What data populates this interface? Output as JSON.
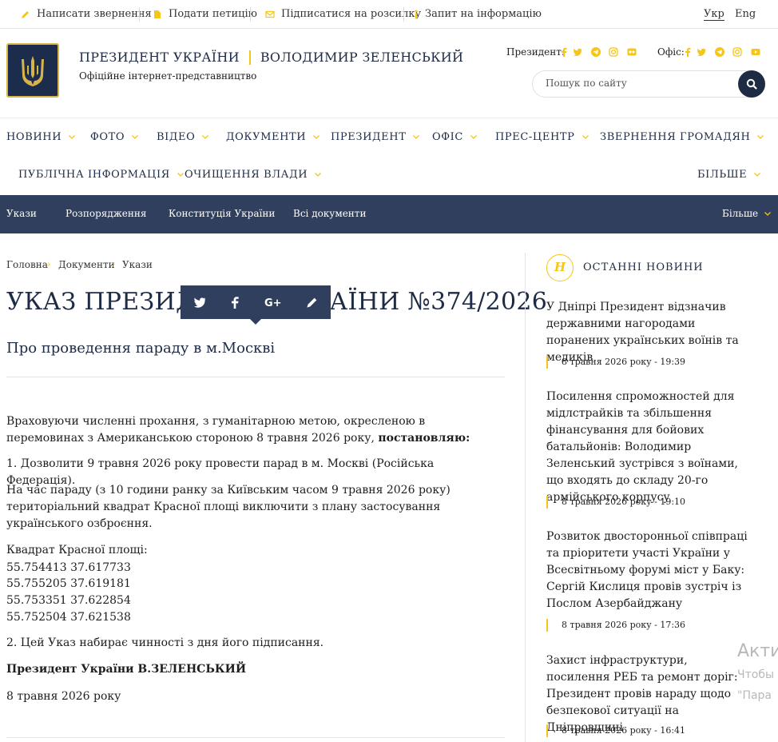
{
  "topbar": {
    "links": [
      "Написати звернення",
      "Подати петицію",
      "Підписатися на розсилку",
      "Запит на інформацію"
    ],
    "lang_active": "Укр",
    "lang_other": "Eng"
  },
  "header": {
    "title_left": "ПРЕЗИДЕНТ УКРАЇНИ",
    "title_right": "ВОЛОДИМИР ЗЕЛЕНСЬКИЙ",
    "subtitle": "Офіційне інтернет-представництво",
    "president_label": "Президент:",
    "office_label": "Офіс:",
    "search_placeholder": "Пошук по сайту"
  },
  "nav": {
    "row1": [
      "НОВИНИ",
      "ФОТО",
      "ВІДЕО",
      "ДОКУМЕНТИ",
      "ПРЕЗИДЕНТ",
      "ОФІС",
      "ПРЕС-ЦЕНТР",
      "ЗВЕРНЕННЯ ГРОМАДЯН"
    ],
    "row2": [
      "ПУБЛІЧНА ІНФОРМАЦІЯ",
      "ОЧИЩЕННЯ ВЛАДИ"
    ],
    "more": "БІЛЬШЕ"
  },
  "subnav": {
    "items": [
      "Укази",
      "Розпорядження",
      "Конституція України",
      "Всі документи"
    ],
    "more": "Більше"
  },
  "breadcrumb": [
    "Головна",
    "Документи",
    "Укази"
  ],
  "article": {
    "title": "УКАЗ ПРЕЗИДЕНТА УКРАЇНИ №374/2026",
    "subtitle": "Про проведення параду в м.Москві",
    "para1_text": "Враховуючи численні прохання, з гуманітарною метою, окресленою в перемовинах з Американською стороною 8 травня 2026 року, ",
    "para1_bold": "постановляю:",
    "para2": "1. Дозволити 9 травня 2026 року провести парад в м. Москві (Російська Федерація).",
    "para3": "На час параду (з 10 години ранку за Київським часом 9 травня 2026 року) територіальний квадрат Красної площі виключити з плану застосування українського озброєння.",
    "coords_label": "Квадрат Красної площі:",
    "coords": [
      "55.754413 37.617733",
      "55.755205 37.619181",
      "55.753351 37.622854",
      "55.752504 37.621538"
    ],
    "para4": "2. Цей Указ набирає чинності з дня його підписання.",
    "signature": "Президент України В.ЗЕЛЕНСЬКИЙ",
    "date": "8 травня 2026 року"
  },
  "sidebar": {
    "icon_letter": "Н",
    "heading": "ОСТАННІ НОВИНИ",
    "news": [
      {
        "title": "У Дніпрі Президент відзначив державними нагородами поранених українських воїнів та медиків",
        "date": "8 травня 2026 року - 19:39"
      },
      {
        "title": "Посилення спроможностей для мідлстрайків та збільшення фінансування для бойових батальйонів: Володимир Зеленський зустрівся з воїнами, що входять до складу 20-го армійського корпусу",
        "date": "8 травня 2026 року - 19:10"
      },
      {
        "title": "Розвиток двосторонньої співпраці та пріоритети участі України у Всесвітньому форумі міст у Баку: Сергій Кислиця провів зустріч із Послом Азербайджану",
        "date": "8 травня 2026 року - 17:36"
      },
      {
        "title": "Захист інфраструктури, посилення РЕБ та ремонт доріг: Президент провів нараду щодо безпекової ситуації на Дніпровщині",
        "date": "8 травня 2026 року - 16:41"
      }
    ]
  },
  "watermark": {
    "line1": "Акти",
    "line2": "Чтобы",
    "line3": "\"Пара"
  },
  "colors": {
    "accent": "#f5c518",
    "navy": "#1e2b45",
    "subnav_bg": "#2f3f5d"
  }
}
